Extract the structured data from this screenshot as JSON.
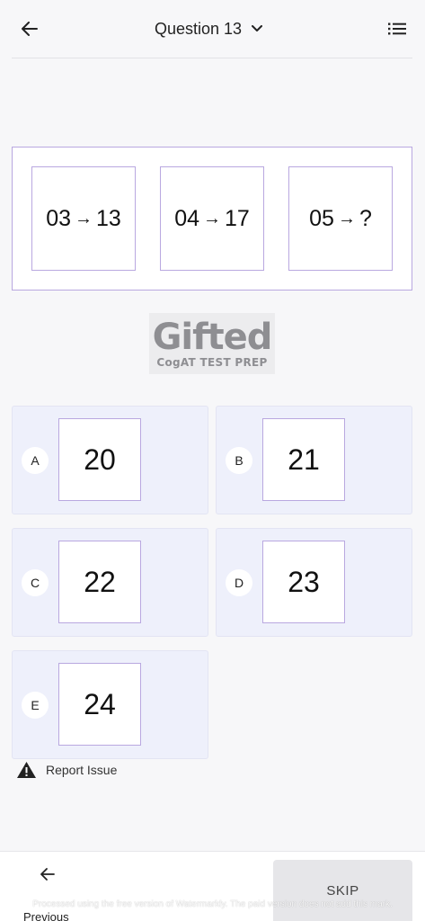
{
  "header": {
    "title": "Question 13",
    "back_icon": "arrow-left-icon",
    "dropdown_icon": "chevron-down-icon",
    "menu_icon": "list-icon"
  },
  "question": {
    "items": [
      {
        "left": "03",
        "right": "13"
      },
      {
        "left": "04",
        "right": "17"
      },
      {
        "left": "05",
        "right": "?"
      }
    ],
    "arrow": "→"
  },
  "logo": {
    "big": "Gifted",
    "small": "CogAT TEST PREP"
  },
  "options": [
    {
      "letter": "A",
      "value": "20"
    },
    {
      "letter": "B",
      "value": "21"
    },
    {
      "letter": "C",
      "value": "22"
    },
    {
      "letter": "D",
      "value": "23"
    },
    {
      "letter": "E",
      "value": "24"
    }
  ],
  "report": {
    "label": "Report Issue",
    "icon": "warning-triangle-icon"
  },
  "footer": {
    "previous_label": "Previous",
    "skip_label": "SKIP"
  },
  "watermark": "Processed using the free version of Watermarkly. The paid version does not add this mark.",
  "colors": {
    "accent_border": "#b9a8e0",
    "option_bg": "#eef0fb",
    "page_bg": "#f7f7f9",
    "skip_bg": "#e6e6e9"
  }
}
